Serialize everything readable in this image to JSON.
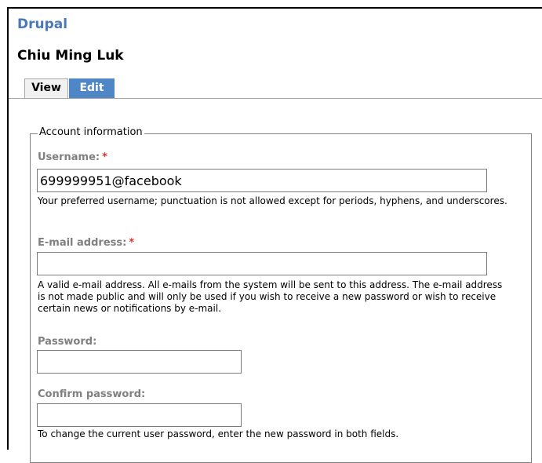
{
  "site": {
    "name": "Drupal"
  },
  "page": {
    "title": "Chiu Ming Luk"
  },
  "tabs": [
    {
      "label": "View",
      "active": false
    },
    {
      "label": "Edit",
      "active": true
    }
  ],
  "fieldset": {
    "legend": "Account information",
    "username": {
      "label": "Username:",
      "required_mark": "*",
      "value": "699999951@facebook",
      "description": "Your preferred username; punctuation is not allowed except for periods, hyphens, and underscores."
    },
    "email": {
      "label": "E-mail address:",
      "required_mark": "*",
      "value": "",
      "description": "A valid e-mail address. All e-mails from the system will be sent to this address. The e-mail address is not made public and will only be used if you wish to receive a new password or wish to receive certain news or notifications by e-mail."
    },
    "password": {
      "label": "Password:",
      "value": ""
    },
    "confirm_password": {
      "label": "Confirm password:",
      "value": "",
      "description": "To change the current user password, enter the new password in both fields."
    }
  },
  "colors": {
    "site_name": "#4a79b6",
    "active_tab": "#4f86c6",
    "inactive_tab": "#f1f1f1",
    "label": "#808080",
    "required": "#e03131"
  }
}
